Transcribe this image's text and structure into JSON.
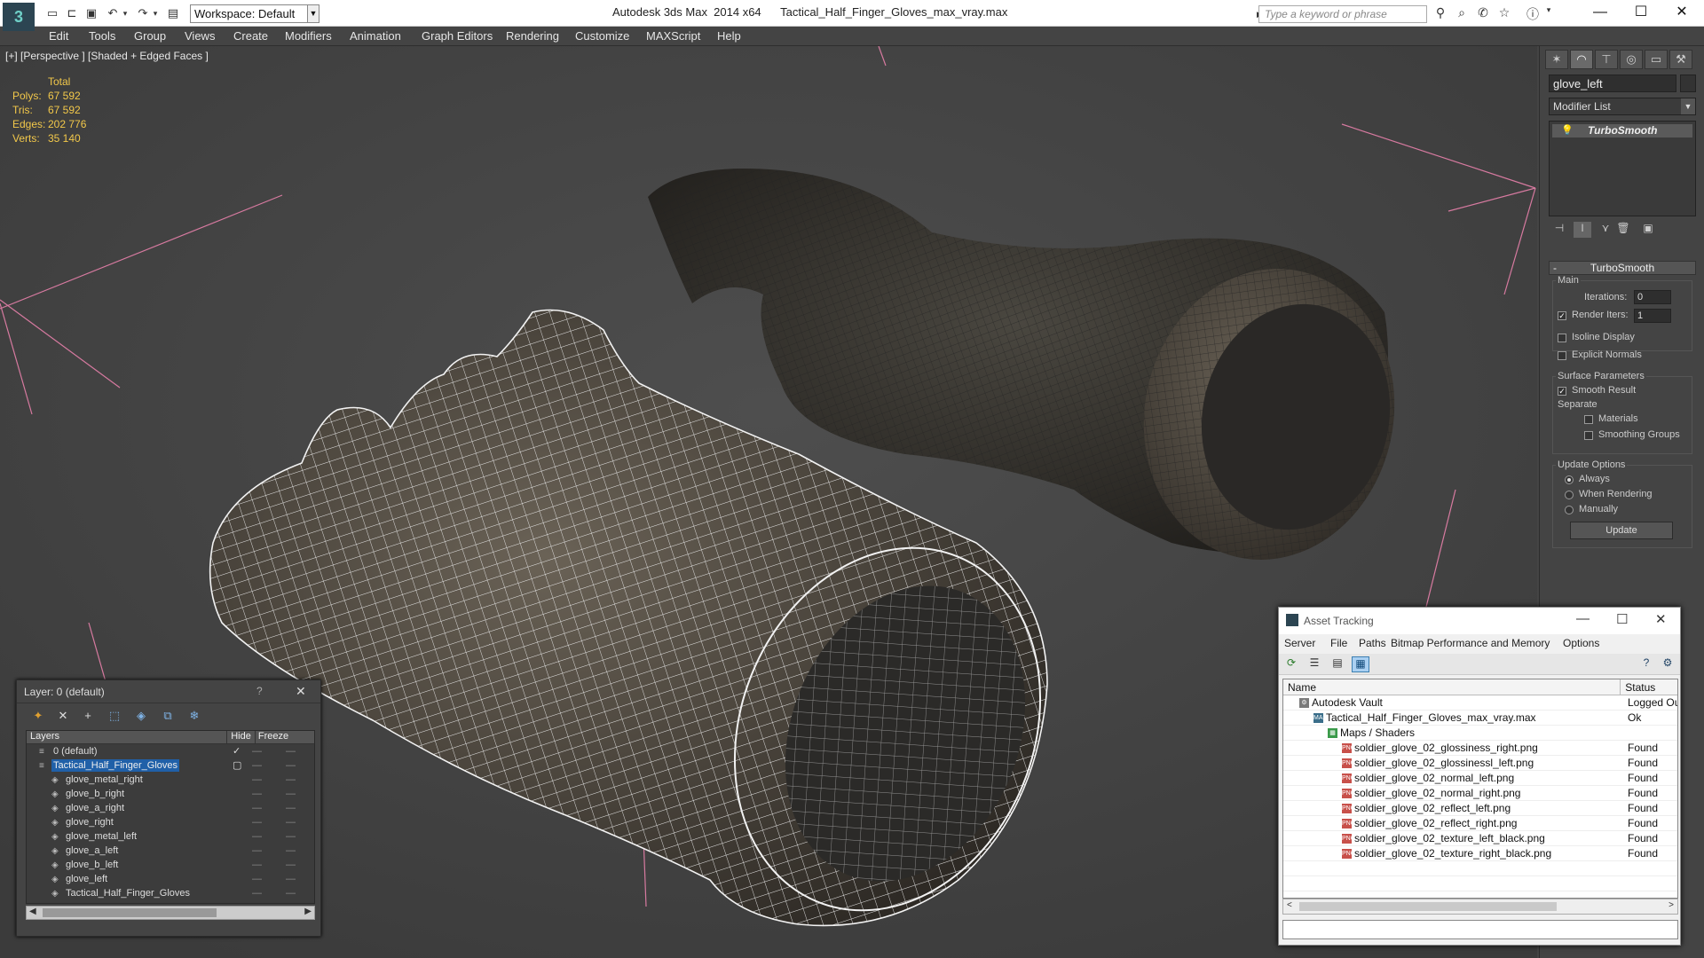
{
  "titlebar": {
    "workspace": "Workspace: Default",
    "app_title": "Autodesk 3ds Max  2014 x64      Tactical_Half_Finger_Gloves_max_vray.max",
    "search_placeholder": "Type a keyword or phrase"
  },
  "menu": [
    "Edit",
    "Tools",
    "Group",
    "Views",
    "Create",
    "Modifiers",
    "Animation",
    "Graph Editors",
    "Rendering",
    "Customize",
    "MAXScript",
    "Help"
  ],
  "viewport": {
    "label": "[+] [Perspective ] [Shaded + Edged Faces ]",
    "stats_total": "Total",
    "stats": [
      {
        "label": "Polys:",
        "value": "67 592"
      },
      {
        "label": "Tris:",
        "value": "67 592"
      },
      {
        "label": "Edges:",
        "value": "202 776"
      },
      {
        "label": "Verts:",
        "value": "35 140"
      }
    ]
  },
  "command_panel": {
    "object_name": "glove_left",
    "modifier_list": "Modifier List",
    "stack_item": "TurboSmooth",
    "rollout_title": "TurboSmooth",
    "main_group": "Main",
    "iterations_label": "Iterations:",
    "iterations_value": "0",
    "render_iters_label": "Render Iters:",
    "render_iters_value": "1",
    "isoline_label": "Isoline Display",
    "explicit_normals_label": "Explicit Normals",
    "surface_group": "Surface Parameters",
    "smooth_result_label": "Smooth Result",
    "separate_label": "Separate",
    "materials_label": "Materials",
    "smoothing_groups_label": "Smoothing Groups",
    "update_group": "Update Options",
    "always_label": "Always",
    "when_rendering_label": "When Rendering",
    "manually_label": "Manually",
    "update_button": "Update"
  },
  "layer_panel": {
    "title": "Layer: 0 (default)",
    "help": "?",
    "col_layers": "Layers",
    "col_hide": "Hide",
    "col_freeze": "Freeze",
    "rows": [
      {
        "name": "0 (default)",
        "level": 0,
        "selected": false,
        "mark": "✓"
      },
      {
        "name": "Tactical_Half_Finger_Gloves",
        "level": 0,
        "selected": true,
        "mark": "▢"
      },
      {
        "name": "glove_metal_right",
        "level": 1,
        "selected": false,
        "mark": ""
      },
      {
        "name": "glove_b_right",
        "level": 1,
        "selected": false,
        "mark": ""
      },
      {
        "name": "glove_a_right",
        "level": 1,
        "selected": false,
        "mark": ""
      },
      {
        "name": "glove_right",
        "level": 1,
        "selected": false,
        "mark": ""
      },
      {
        "name": "glove_metal_left",
        "level": 1,
        "selected": false,
        "mark": ""
      },
      {
        "name": "glove_a_left",
        "level": 1,
        "selected": false,
        "mark": ""
      },
      {
        "name": "glove_b_left",
        "level": 1,
        "selected": false,
        "mark": ""
      },
      {
        "name": "glove_left",
        "level": 1,
        "selected": false,
        "mark": ""
      },
      {
        "name": "Tactical_Half_Finger_Gloves",
        "level": 1,
        "selected": false,
        "mark": ""
      }
    ]
  },
  "asset_tracking": {
    "title": "Asset Tracking",
    "menu": [
      "Server",
      "File",
      "Paths",
      "Bitmap Performance and Memory",
      "Options"
    ],
    "col_name": "Name",
    "col_status": "Status",
    "rows": [
      {
        "name": "Autodesk Vault",
        "status": "Logged Out",
        "indent": 0,
        "icon": "vault"
      },
      {
        "name": "Tactical_Half_Finger_Gloves_max_vray.max",
        "status": "Ok",
        "indent": 1,
        "icon": "max"
      },
      {
        "name": "Maps / Shaders",
        "status": "",
        "indent": 2,
        "icon": "maps"
      },
      {
        "name": "soldier_glove_02_glossiness_right.png",
        "status": "Found",
        "indent": 3,
        "icon": "png"
      },
      {
        "name": "soldier_glove_02_glossinessl_left.png",
        "status": "Found",
        "indent": 3,
        "icon": "png"
      },
      {
        "name": "soldier_glove_02_normal_left.png",
        "status": "Found",
        "indent": 3,
        "icon": "png"
      },
      {
        "name": "soldier_glove_02_normal_right.png",
        "status": "Found",
        "indent": 3,
        "icon": "png"
      },
      {
        "name": "soldier_glove_02_reflect_left.png",
        "status": "Found",
        "indent": 3,
        "icon": "png"
      },
      {
        "name": "soldier_glove_02_reflect_right.png",
        "status": "Found",
        "indent": 3,
        "icon": "png"
      },
      {
        "name": "soldier_glove_02_texture_left_black.png",
        "status": "Found",
        "indent": 3,
        "icon": "png"
      },
      {
        "name": "soldier_glove_02_texture_right_black.png",
        "status": "Found",
        "indent": 3,
        "icon": "png"
      }
    ]
  },
  "colors": {
    "stats_text": "#f2c84a",
    "selection": "#2060a8",
    "viewport_bg": "#474747",
    "guide_lines": "#d77aa0"
  }
}
